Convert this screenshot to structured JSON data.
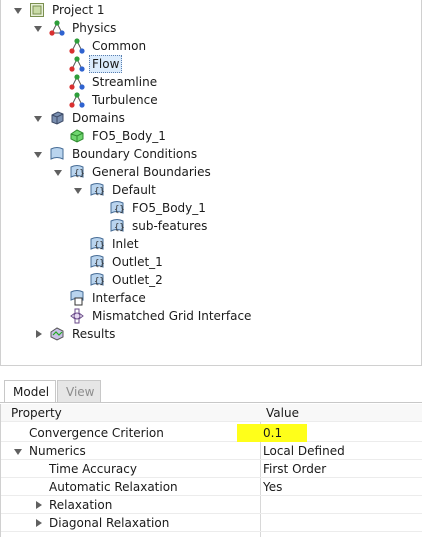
{
  "tree": {
    "project": "Project 1",
    "physics": {
      "label": "Physics",
      "children": [
        "Common",
        "Flow",
        "Streamline",
        "Turbulence"
      ],
      "selected": "Flow"
    },
    "domains": {
      "label": "Domains",
      "children": [
        "FO5_Body_1"
      ]
    },
    "boundary_conditions": {
      "label": "Boundary Conditions",
      "general_boundaries": {
        "label": "General Boundaries",
        "default": {
          "label": "Default",
          "children": [
            "FO5_Body_1",
            "sub-features"
          ]
        },
        "others": [
          "Inlet",
          "Outlet_1",
          "Outlet_2"
        ]
      },
      "interface": "Interface",
      "mismatched": "Mismatched Grid Interface"
    },
    "results": "Results"
  },
  "tabs": {
    "model": "Model",
    "view": "View"
  },
  "table": {
    "header_property": "Property",
    "header_value": "Value",
    "rows": [
      {
        "property": "Convergence Criterion",
        "value": "0.1"
      },
      {
        "property": "Numerics",
        "value": "Local Defined"
      },
      {
        "property": "Time Accuracy",
        "value": "First Order"
      },
      {
        "property": "Automatic Relaxation",
        "value": "Yes"
      },
      {
        "property": "Relaxation",
        "value": ""
      },
      {
        "property": "Diagonal Relaxation",
        "value": ""
      }
    ],
    "highlight_color": "#ffff1a"
  },
  "icons": {
    "project": "project-icon",
    "physics": "physics-node-icon",
    "domain": "domain-icon",
    "boundary": "boundary-icon",
    "interface": "interface-icon",
    "mismatched": "mismatched-grid-icon",
    "results": "results-icon"
  }
}
